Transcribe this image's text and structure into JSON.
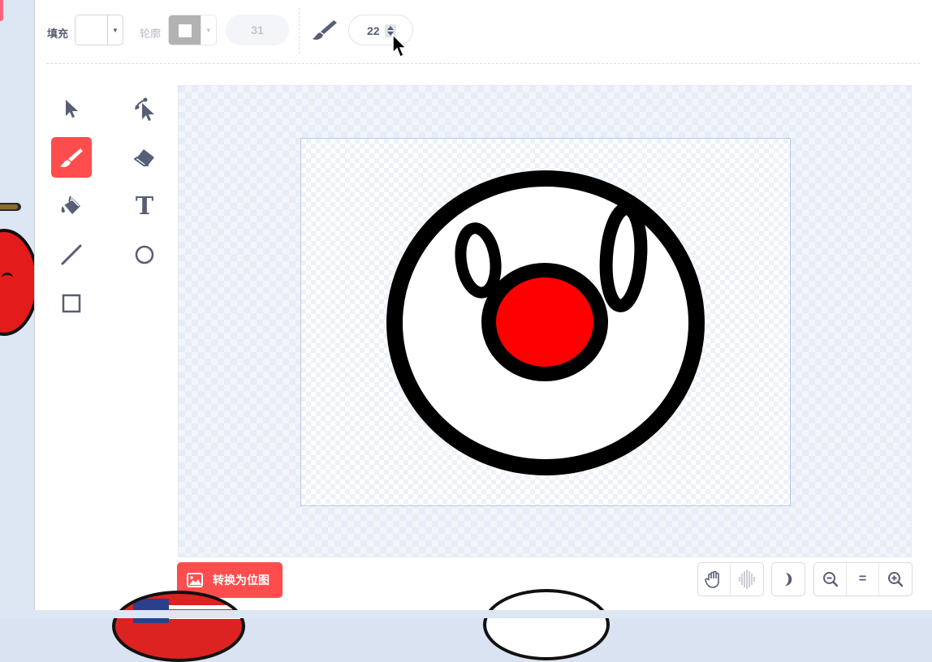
{
  "toolbar": {
    "fill_label": "填充",
    "fill_color": "#ffffff",
    "outline_label": "轮廓",
    "outline_width": "31",
    "brush_size": "22"
  },
  "tools": {
    "select": "select-arrow-icon",
    "reshape": "reshape-icon",
    "brush": "brush-icon",
    "eraser": "eraser-icon",
    "fill": "fill-bucket-icon",
    "text": "T",
    "line": "line-icon",
    "circle": "circle-icon",
    "rectangle": "rectangle-icon",
    "active": "brush",
    "active_color": "#ff4d4d"
  },
  "canvas": {
    "drawing_colors": {
      "outline": "#000000",
      "face": "#ffffff",
      "nose": "#ff0000"
    }
  },
  "bottom": {
    "convert_label": "转换为位图",
    "equal_label": "="
  }
}
